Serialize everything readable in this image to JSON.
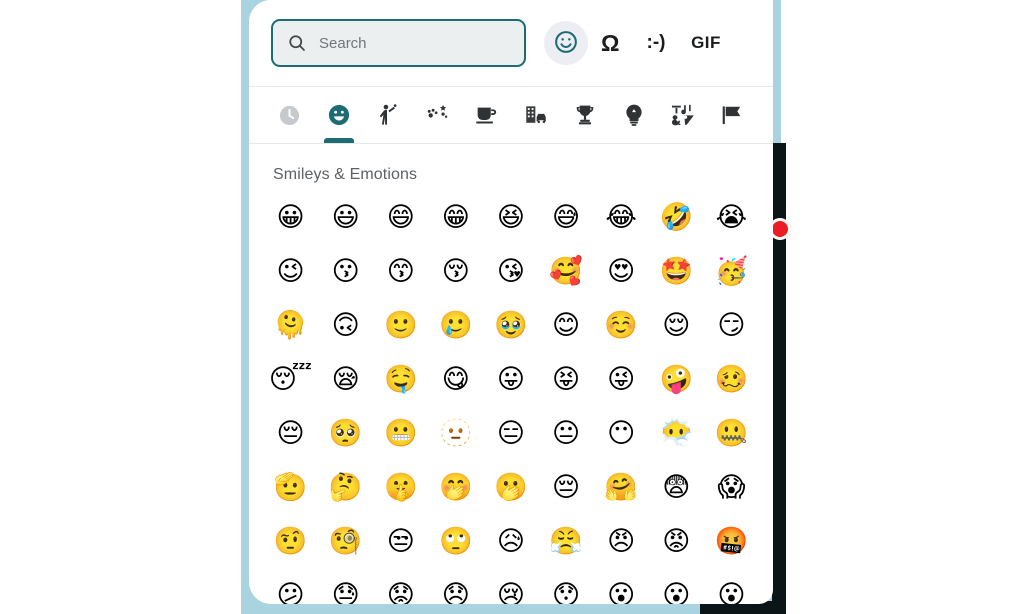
{
  "panel": {
    "search": {
      "placeholder": "Search",
      "value": "",
      "icon": "search-icon"
    },
    "top_actions": [
      {
        "name": "emoji-toggle",
        "label": "☺",
        "icon": "smiley-outline-icon",
        "active": true
      },
      {
        "name": "symbols-toggle",
        "label": "Ω",
        "icon": "omega-icon",
        "active": false
      },
      {
        "name": "emoticons-toggle",
        "label": ":-)",
        "icon": "emoticon-icon",
        "active": false
      },
      {
        "name": "gif-toggle",
        "label": "GIF",
        "icon": "gif-icon",
        "active": false
      }
    ],
    "tabs": [
      {
        "name": "tab-recent",
        "label": "Recently used",
        "icon": "clock-icon",
        "state": "muted"
      },
      {
        "name": "tab-smileys",
        "label": "Smileys & Emotions",
        "icon": "smiley-filled-icon",
        "state": "active"
      },
      {
        "name": "tab-people",
        "label": "People",
        "icon": "person-waving-icon",
        "state": "normal"
      },
      {
        "name": "tab-nature",
        "label": "Animals & Nature",
        "icon": "paw-flower-icon",
        "state": "normal"
      },
      {
        "name": "tab-food",
        "label": "Food & Drink",
        "icon": "cup-icon",
        "state": "normal"
      },
      {
        "name": "tab-travel",
        "label": "Travel & Places",
        "icon": "building-car-icon",
        "state": "normal"
      },
      {
        "name": "tab-activities",
        "label": "Activities",
        "icon": "trophy-icon",
        "state": "normal"
      },
      {
        "name": "tab-objects",
        "label": "Objects",
        "icon": "lightbulb-icon",
        "state": "normal"
      },
      {
        "name": "tab-symbols",
        "label": "Symbols",
        "icon": "music-ampersand-percent-icon",
        "state": "normal"
      },
      {
        "name": "tab-flags",
        "label": "Flags",
        "icon": "flag-icon",
        "state": "normal"
      }
    ],
    "section_title": "Smileys & Emotions",
    "emoji_rows": [
      [
        "😀",
        "😃",
        "😄",
        "😁",
        "😆",
        "😅",
        "😂",
        "🤣",
        "😭"
      ],
      [
        "😉",
        "😗",
        "😙",
        "😚",
        "😘",
        "🥰",
        "😍",
        "🤩",
        "🥳"
      ],
      [
        "🫠",
        "🙃",
        "🙂",
        "🥲",
        "🥹",
        "😊",
        "☺️",
        "😌",
        "😏"
      ],
      [
        "😴",
        "😪",
        "🤤",
        "😋",
        "😛",
        "😝",
        "😜",
        "🤪",
        "🥴"
      ],
      [
        "😔",
        "🥺",
        "😬",
        "🫥",
        "😑",
        "😐",
        "😶",
        "😶‍🌫️",
        "🤐"
      ],
      [
        "🫡",
        "🤔",
        "🤫",
        "🤭",
        "🫢",
        "😔",
        "🤗",
        "😨",
        "😱"
      ],
      [
        "🤨",
        "🧐",
        "😒",
        "🙄",
        "😥",
        "😤",
        "😠",
        "😡",
        "🤬"
      ],
      [
        "😕",
        "😓",
        "😟",
        "😞",
        "😢",
        "😯",
        "😮",
        "😮",
        "😮"
      ]
    ]
  },
  "colors": {
    "background_band": "#a9d3de",
    "panel_background": "#ffffff",
    "accent_teal": "#1d6b73",
    "dark_strip": "#0b1416",
    "record_red": "#ed1c24",
    "search_fill": "#eceff0",
    "active_chip": "#eceef4"
  },
  "overlay": {
    "record_indicator": "record-dot"
  }
}
